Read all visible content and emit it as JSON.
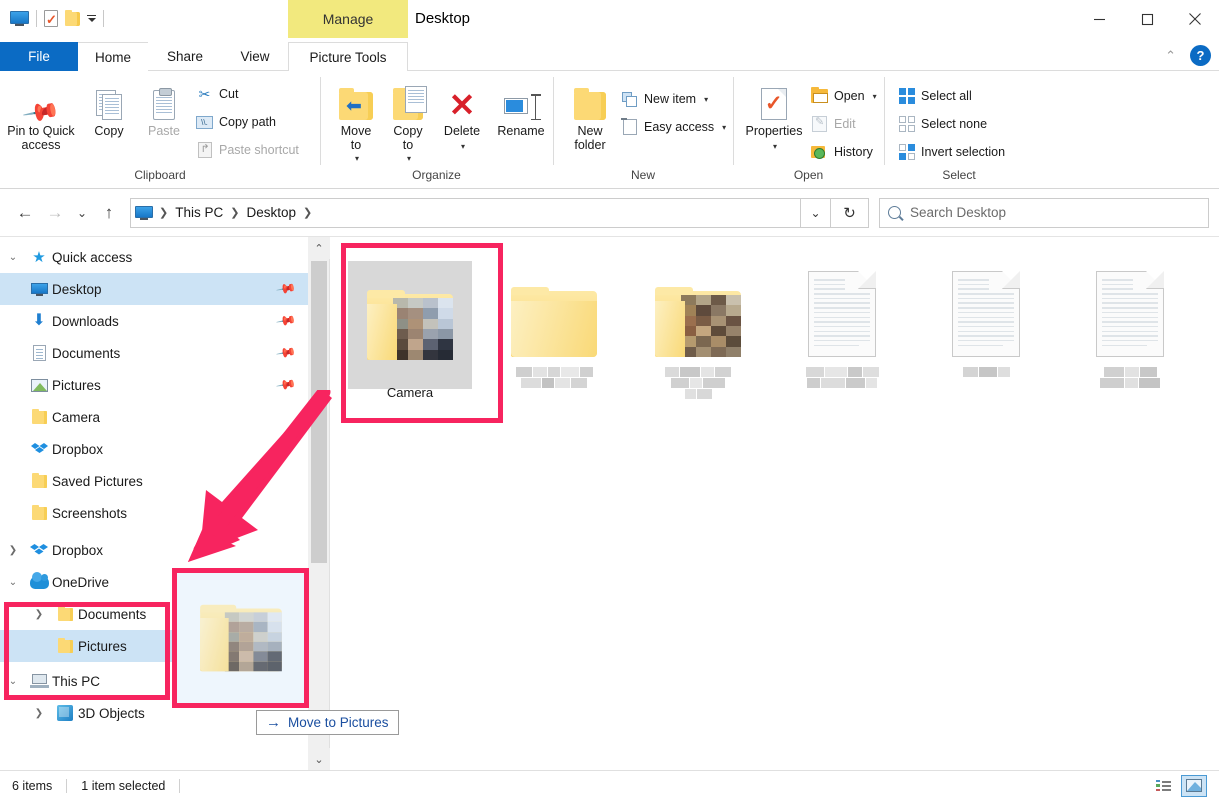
{
  "window": {
    "title": "Desktop",
    "contextual_tab_group": "Manage",
    "minimize": "—",
    "maximize": "▢",
    "close": "✕",
    "collapse_ribbon": "⌃",
    "help": "?"
  },
  "quick_access_toolbar": [
    {
      "name": "this-pc-icon",
      "label": ""
    },
    {
      "name": "properties-icon",
      "label": ""
    },
    {
      "name": "new-folder-icon",
      "label": ""
    },
    {
      "name": "customize-qat-dropdown",
      "label": ""
    }
  ],
  "tabs": [
    {
      "id": "file",
      "label": "File",
      "active": false
    },
    {
      "id": "home",
      "label": "Home",
      "active": true
    },
    {
      "id": "share",
      "label": "Share",
      "active": false
    },
    {
      "id": "view",
      "label": "View",
      "active": false
    },
    {
      "id": "picture-tools",
      "label": "Picture Tools",
      "active": false
    }
  ],
  "ribbon": {
    "groups": [
      {
        "name": "Clipboard",
        "large": [
          {
            "label": "Pin to Quick access",
            "icon": "pin-icon"
          },
          {
            "label": "Copy",
            "icon": "copy-icon"
          },
          {
            "label": "Paste",
            "icon": "paste-icon",
            "disabled": true
          }
        ],
        "small": [
          {
            "label": "Cut",
            "icon": "scissors-icon",
            "disabled": false
          },
          {
            "label": "Copy path",
            "icon": "copy-path-icon",
            "disabled": false
          },
          {
            "label": "Paste shortcut",
            "icon": "paste-shortcut-icon",
            "disabled": true
          }
        ]
      },
      {
        "name": "Organize",
        "large": [
          {
            "label": "Move to",
            "icon": "move-to-icon",
            "dropdown": true
          },
          {
            "label": "Copy to",
            "icon": "copy-to-icon",
            "dropdown": true
          },
          {
            "label": "Delete",
            "icon": "delete-icon",
            "dropdown": true
          },
          {
            "label": "Rename",
            "icon": "rename-icon"
          }
        ],
        "small": []
      },
      {
        "name": "New",
        "large": [
          {
            "label": "New folder",
            "icon": "new-folder-icon"
          }
        ],
        "small": [
          {
            "label": "New item",
            "icon": "new-item-icon",
            "dropdown": true
          },
          {
            "label": "Easy access",
            "icon": "easy-access-icon",
            "dropdown": true
          }
        ]
      },
      {
        "name": "Open",
        "large": [
          {
            "label": "Properties",
            "icon": "properties-icon",
            "dropdown": true
          }
        ],
        "small": [
          {
            "label": "Open",
            "icon": "open-folder-icon",
            "dropdown": true
          },
          {
            "label": "Edit",
            "icon": "edit-icon",
            "disabled": true
          },
          {
            "label": "History",
            "icon": "history-icon"
          }
        ]
      },
      {
        "name": "Select",
        "large": [],
        "small": [
          {
            "label": "Select all",
            "icon": "select-all-icon"
          },
          {
            "label": "Select none",
            "icon": "select-none-icon"
          },
          {
            "label": "Invert selection",
            "icon": "invert-selection-icon"
          }
        ]
      }
    ]
  },
  "addressbar": {
    "back": "←",
    "forward": "→",
    "recent": "⌄",
    "up": "↑",
    "breadcrumbs": [
      "This PC",
      "Desktop"
    ],
    "dropdown": "⌄",
    "refresh": "↻"
  },
  "search": {
    "placeholder": "Search Desktop",
    "value": ""
  },
  "sidebar": {
    "items": [
      {
        "label": "Quick access",
        "icon": "star-icon",
        "twisty": "expanded",
        "indent": 0,
        "selected": false,
        "pinned": false
      },
      {
        "label": "Desktop",
        "icon": "monitor-icon",
        "twisty": "",
        "indent": 1,
        "selected": true,
        "pinned": true
      },
      {
        "label": "Downloads",
        "icon": "download-icon",
        "twisty": "",
        "indent": 1,
        "selected": false,
        "pinned": true
      },
      {
        "label": "Documents",
        "icon": "document-icon",
        "twisty": "",
        "indent": 1,
        "selected": false,
        "pinned": true
      },
      {
        "label": "Pictures",
        "icon": "pictures-icon",
        "twisty": "",
        "indent": 1,
        "selected": false,
        "pinned": true
      },
      {
        "label": "Camera",
        "icon": "folder-icon",
        "twisty": "",
        "indent": 1,
        "selected": false,
        "pinned": false
      },
      {
        "label": "Dropbox",
        "icon": "dropbox-folder-icon",
        "twisty": "",
        "indent": 1,
        "selected": false,
        "pinned": false
      },
      {
        "label": "Saved Pictures",
        "icon": "folder-icon",
        "twisty": "",
        "indent": 1,
        "selected": false,
        "pinned": false
      },
      {
        "label": "Screenshots",
        "icon": "folder-icon",
        "twisty": "",
        "indent": 1,
        "selected": false,
        "pinned": false
      },
      {
        "label": "Dropbox",
        "icon": "dropbox-icon",
        "twisty": "collapsed",
        "indent": 0,
        "selected": false,
        "pinned": false
      },
      {
        "label": "OneDrive",
        "icon": "cloud-icon",
        "twisty": "expanded",
        "indent": 0,
        "selected": false,
        "pinned": false
      },
      {
        "label": "Documents",
        "icon": "folder-icon",
        "twisty": "collapsed",
        "indent": 1,
        "selected": false,
        "pinned": false
      },
      {
        "label": "Pictures",
        "icon": "folder-icon",
        "twisty": "",
        "indent": 1,
        "selected": true,
        "pinned": false
      },
      {
        "label": "This PC",
        "icon": "this-pc-icon",
        "twisty": "expanded",
        "indent": 0,
        "selected": false,
        "pinned": false
      },
      {
        "label": "3D Objects",
        "icon": "3d-objects-icon",
        "twisty": "collapsed",
        "indent": 1,
        "selected": false,
        "pinned": false
      }
    ],
    "scroll_up": "⌃",
    "scroll_down": "⌄"
  },
  "files": [
    {
      "name": "Camera",
      "type": "folder-with-pictures",
      "selected": true,
      "blurred": false
    },
    {
      "name": "",
      "type": "folder-empty",
      "selected": false,
      "blurred": true
    },
    {
      "name": "",
      "type": "folder-with-pictures",
      "selected": false,
      "blurred": true
    },
    {
      "name": "",
      "type": "document",
      "selected": false,
      "blurred": true
    },
    {
      "name": "",
      "type": "document",
      "selected": false,
      "blurred": true
    },
    {
      "name": "",
      "type": "document",
      "selected": false,
      "blurred": true
    }
  ],
  "drag": {
    "tooltip_label": "Move to Pictures",
    "tooltip_arrow": "→"
  },
  "statusbar": {
    "item_count": "6 items",
    "selection": "1 item selected",
    "view_details": "details-view-icon",
    "view_large_icons": "large-icons-view-icon"
  },
  "colors": {
    "highlight": "#f7245f",
    "file_tab": "#0b6bc4",
    "contextual_tab": "#f2e97e",
    "selection": "#cce3f5",
    "folder": "#fcd975"
  }
}
